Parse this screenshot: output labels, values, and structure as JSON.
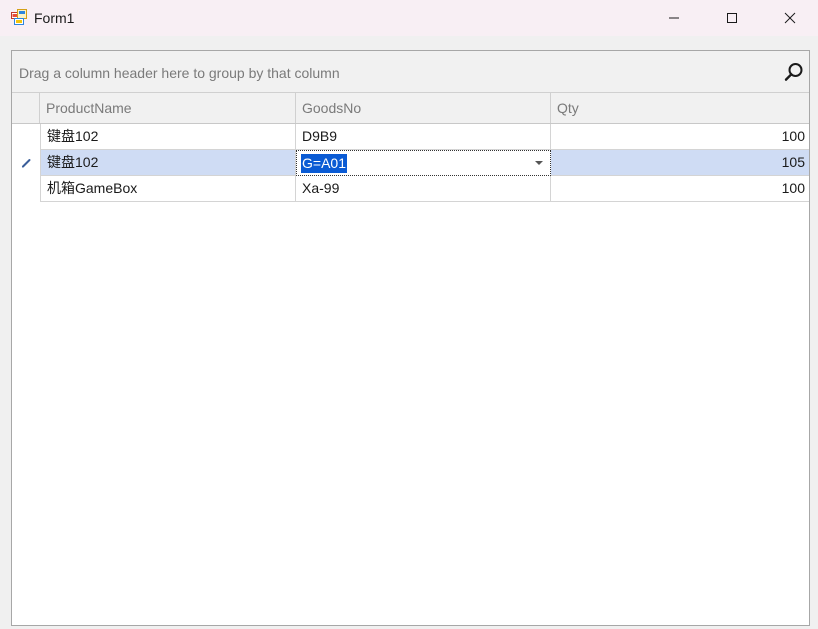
{
  "window": {
    "title": "Form1"
  },
  "grid": {
    "group_panel_text": "Drag a column header here to group by that column",
    "columns": [
      "ProductName",
      "GoodsNo",
      "Qty"
    ],
    "rows": [
      {
        "ProductName": "键盘102",
        "GoodsNo": "D9B9",
        "Qty": "100"
      },
      {
        "ProductName": "键盘102",
        "GoodsNo": "G=A01",
        "Qty": "105"
      },
      {
        "ProductName": "机箱GameBox",
        "GoodsNo": "Xa-99",
        "Qty": "100"
      }
    ],
    "editing_value": "G=A01"
  },
  "icons": {
    "app": "form-icon",
    "find": "search-icon",
    "edit_indicator": "pencil-icon",
    "dropdown": "chevron-down-icon"
  },
  "colors": {
    "selection": "#0a5bd4",
    "focused_row": "#cfdcf4"
  }
}
